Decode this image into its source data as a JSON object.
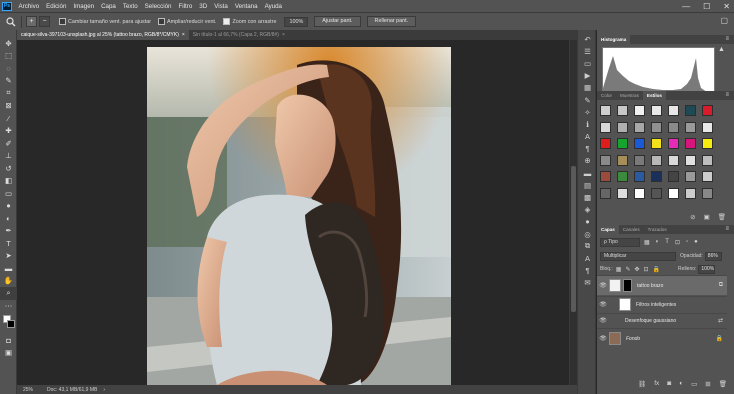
{
  "app": {
    "logo": "Ps"
  },
  "menu": [
    "Archivo",
    "Edición",
    "Imagen",
    "Capa",
    "Texto",
    "Selección",
    "Filtro",
    "3D",
    "Vista",
    "Ventana",
    "Ayuda"
  ],
  "window_controls": {
    "minimize": "—",
    "maximize": "☐",
    "close": "✕"
  },
  "options": {
    "zoom_in": "+",
    "zoom_out": "−",
    "resize_windows_label": "Cambiar tamaño vent. para ajustar",
    "resize_windows_checked": false,
    "zoom_all_label": "Ampliar/reducir vent.",
    "zoom_all_checked": false,
    "scrubby_zoom_label": "Zoom con arrastre",
    "scrubby_zoom_checked": true,
    "zoom_value": "100%",
    "fit_screen_label": "Ajustar pant.",
    "fill_screen_label": "Rellenar pant."
  },
  "tabs": [
    {
      "label": "caique-silva-397103-unsplash.jpg al 25% (tattoo brazo, RGB/8*/CMYK)",
      "close": "×",
      "active": true
    },
    {
      "label": "Sin título-1 al 66,7% (Capa 2, RGB/8#)",
      "close": "×",
      "active": false
    }
  ],
  "status": {
    "zoom": "25%",
    "doc_info": "Doc: 43,1 MB/61,9 MB",
    "arrow": "›"
  },
  "panels": {
    "histogram": {
      "title": "Histograma",
      "warning": "▲"
    },
    "swatches_tabs": [
      "Color",
      "Muestras",
      "Estilos"
    ],
    "swatches_active": 2,
    "style_colors": [
      "#d0d0d0",
      "#c8c8c8",
      "#f0f0f0",
      "#e8e8e8",
      "#e8e8e8",
      "#1e4a56",
      "#d91c2b",
      "#d8d8d8",
      "#b0b0b0",
      "#a8a8a8",
      "#909090",
      "#8a8a8a",
      "#9a9a9a",
      "#e8e8e8",
      "#e01d1d",
      "#16a32e",
      "#1b5ad6",
      "#f2e11a",
      "#e62bb8",
      "#d8157b",
      "#f6ec10",
      "#8a8a8a",
      "#a58e5a",
      "#7a7a7a",
      "#b8b8b8",
      "#d9d9d9",
      "#e0e0e0",
      "#bdbdbd",
      "#9b4b3b",
      "#3c8a3c",
      "#2a5aa0",
      "#1a2f5a",
      "#444444",
      "#9a9a9a",
      "#cccccc",
      "#666666",
      "#dddddd",
      "#ffffff",
      "#555555",
      "#ffffff",
      "#cccccc",
      "#888888"
    ],
    "layers_tabs": [
      "Capas",
      "Canales",
      "Trazados"
    ],
    "layers_active": 0,
    "filter_kind": "ρ Tipo",
    "blend_mode": "Multiplicar",
    "opacity_label": "Opacidad:",
    "opacity_value": "86%",
    "lock_label": "Bloq.:",
    "fill_label": "Relleno:",
    "fill_value": "100%",
    "layers": [
      {
        "name": "tattoo brazo",
        "visible": true,
        "type": "smart"
      },
      {
        "name": "Filtros inteligentes",
        "visible": true,
        "type": "filters"
      },
      {
        "name": "Desenfoque gaussiano",
        "visible": true,
        "type": "filter"
      },
      {
        "name": "Fondo",
        "visible": true,
        "type": "background"
      }
    ]
  }
}
